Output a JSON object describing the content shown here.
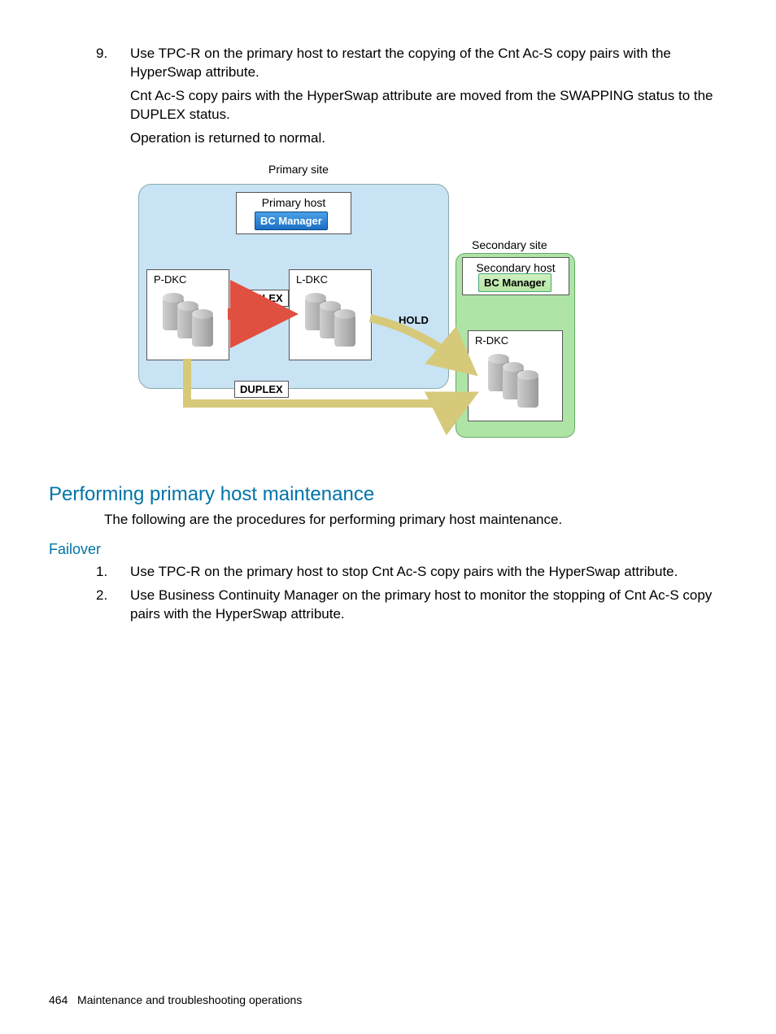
{
  "step9": {
    "number": "9.",
    "text": "Use TPC-R on the primary host to restart the copying of the Cnt Ac-S copy pairs with the HyperSwap attribute.",
    "para1": "Cnt Ac-S copy pairs with the HyperSwap attribute are moved from the SWAPPING status to the DUPLEX status.",
    "para2": "Operation is returned to normal."
  },
  "diagram": {
    "primary_site": "Primary site",
    "primary_host": "Primary host",
    "bc_manager_primary": "BC Manager",
    "secondary_site": "Secondary site",
    "secondary_host": "Secondary host",
    "bc_manager_secondary": "BC Manager",
    "p_dkc": "P-DKC",
    "l_dkc": "L-DKC",
    "r_dkc": "R-DKC",
    "duplex1": "DUPLEX",
    "duplex2": "DUPLEX",
    "hold": "HOLD"
  },
  "section2": {
    "heading": "Performing primary host maintenance",
    "intro": "The following are the procedures for performing primary host maintenance."
  },
  "failover": {
    "heading": "Failover",
    "items": [
      {
        "num": "1.",
        "text": "Use TPC-R on the primary host to stop Cnt Ac-S copy pairs with the HyperSwap attribute."
      },
      {
        "num": "2.",
        "text": "Use Business Continuity Manager on the primary host to monitor the stopping of Cnt Ac-S copy pairs with the HyperSwap attribute."
      }
    ]
  },
  "footer": {
    "page": "464",
    "title": "Maintenance and troubleshooting operations"
  }
}
